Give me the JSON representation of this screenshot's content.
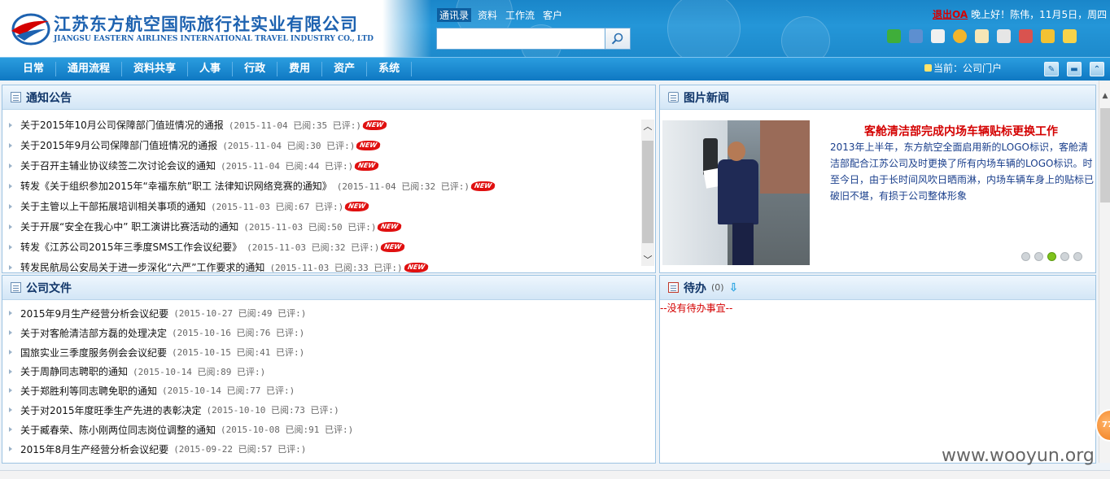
{
  "header": {
    "company_name": "江苏东方航空国际旅行社实业有限公司",
    "company_en": "JIANGSU EASTERN AIRLINES INTERNATIONAL TRAVEL INDUSTRY CO., LTD",
    "search_tabs": [
      "通讯录",
      "资料",
      "工作流",
      "客户"
    ],
    "search_placeholder": "",
    "exit_label": "退出OA",
    "greeting": "晚上好！陈伟，11月5日，周四"
  },
  "nav": {
    "items": [
      "日常",
      "通用流程",
      "资料共享",
      "人事",
      "行政",
      "费用",
      "资产",
      "系统"
    ],
    "current_label": "当前：公司门户"
  },
  "notices": {
    "title": "通知公告",
    "items": [
      {
        "title": "关于2015年10月公司保障部门值班情况的通报",
        "meta": "(2015-11-04 已阅:35 已评:)",
        "new": "NEW"
      },
      {
        "title": "关于2015年9月公司保障部门值班情况的通报",
        "meta": "(2015-11-04 已阅:30 已评:)",
        "new": "NEW"
      },
      {
        "title": "关于召开主辅业协议续签二次讨论会议的通知",
        "meta": "(2015-11-04 已阅:44 已评:)",
        "new": "NEW"
      },
      {
        "title": "转发《关于组织参加2015年“幸福东航”职工 法律知识网络竞赛的通知》",
        "meta": "(2015-11-04 已阅:32 已评:)",
        "new": "NEW"
      },
      {
        "title": "关于主管以上干部拓展培训相关事项的通知",
        "meta": "(2015-11-03 已阅:67 已评:)",
        "new": "NEW"
      },
      {
        "title": "关于开展“安全在我心中” 职工演讲比赛活动的通知",
        "meta": "(2015-11-03 已阅:50 已评:)",
        "new": "NEW"
      },
      {
        "title": "转发《江苏公司2015年三季度SMS工作会议纪要》",
        "meta": "(2015-11-03 已阅:32 已评:)",
        "new": "NEW"
      },
      {
        "title": "转发民航局公安局关于进一步深化“六严”工作要求的通知",
        "meta": "(2015-11-03 已阅:33 已评:)",
        "new": "NEW"
      }
    ]
  },
  "photo_news": {
    "title": "图片新闻",
    "headline": "客舱清洁部完成内场车辆贴标更换工作",
    "body": "2013年上半年，东方航空全面启用新的LOGO标识，客舱清洁部配合江苏公司及时更换了所有内场车辆的LOGO标识。时至今日，由于长时间风吹日晒雨淋，内场车辆车身上的贴标已破旧不堪，有损于公司整体形象",
    "slide_count": 5,
    "active_slide": 3
  },
  "documents": {
    "title": "公司文件",
    "items": [
      {
        "title": "2015年9月生产经营分析会议纪要",
        "meta": "(2015-10-27 已阅:49 已评:)"
      },
      {
        "title": "关于对客舱清洁部方磊的处理决定",
        "meta": "(2015-10-16 已阅:76 已评:)"
      },
      {
        "title": "国旅实业三季度服务例会会议纪要",
        "meta": "(2015-10-15 已阅:41 已评:)"
      },
      {
        "title": "关于周静同志聘职的通知",
        "meta": "(2015-10-14 已阅:89 已评:)"
      },
      {
        "title": "关于郑胜利等同志聘免职的通知",
        "meta": "(2015-10-14 已阅:77 已评:)"
      },
      {
        "title": "关于对2015年度旺季生产先进的表彰决定",
        "meta": "(2015-10-10 已阅:73 已评:)"
      },
      {
        "title": "关于臧春荣、陈小刚两位同志岗位调整的通知",
        "meta": "(2015-10-08 已阅:91 已评:)"
      },
      {
        "title": "2015年8月生产经营分析会议纪要",
        "meta": "(2015-09-22 已阅:57 已评:)"
      }
    ]
  },
  "todo": {
    "title": "待办",
    "count": "(0)",
    "empty_text": "--没有待办事宜--"
  },
  "watermark": "www.wooyun.org",
  "float_badge": "77"
}
